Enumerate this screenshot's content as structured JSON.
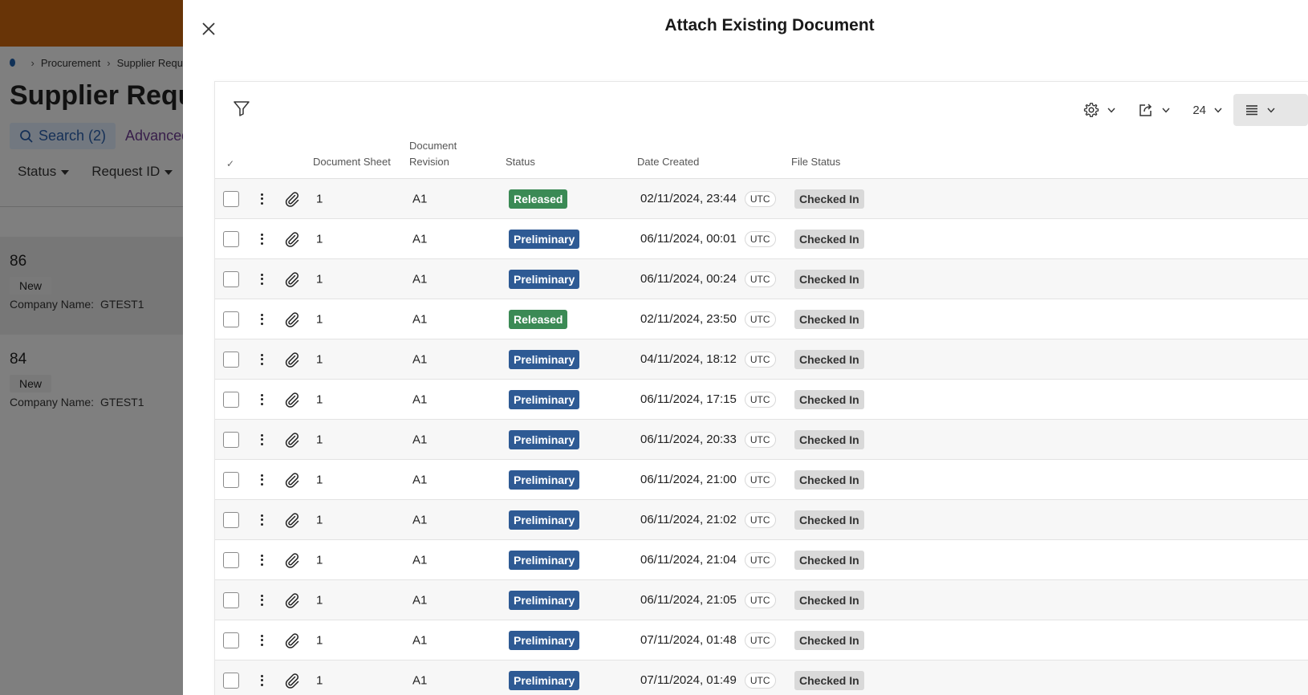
{
  "background": {
    "breadcrumb": [
      "Procurement",
      "Supplier Requ"
    ],
    "page_title": "Supplier Requ",
    "search_label": "Search (2)",
    "advanced_label": "Advanced",
    "filters": [
      "Status",
      "Request ID"
    ],
    "cards": [
      {
        "id": "86",
        "badge": "New",
        "company_label": "Company Name:",
        "company_value": "GTEST1"
      },
      {
        "id": "84",
        "badge": "New",
        "company_label": "Company Name:",
        "company_value": "GTEST1"
      }
    ]
  },
  "dialog": {
    "title": "Attach Existing Document",
    "page_size": "24",
    "columns": {
      "check": "✓",
      "sheet": "Document Sheet",
      "revision_line1": "Document",
      "revision_line2": "Revision",
      "status": "Status",
      "date": "Date Created",
      "file_status": "File Status"
    },
    "rows": [
      {
        "sheet": "1",
        "revision": "A1",
        "status": "Released",
        "status_type": "released",
        "date": "02/11/2024, 23:44",
        "tz": "UTC",
        "file_status": "Checked In"
      },
      {
        "sheet": "1",
        "revision": "A1",
        "status": "Preliminary",
        "status_type": "preliminary",
        "date": "06/11/2024, 00:01",
        "tz": "UTC",
        "file_status": "Checked In"
      },
      {
        "sheet": "1",
        "revision": "A1",
        "status": "Preliminary",
        "status_type": "preliminary",
        "date": "06/11/2024, 00:24",
        "tz": "UTC",
        "file_status": "Checked In"
      },
      {
        "sheet": "1",
        "revision": "A1",
        "status": "Released",
        "status_type": "released",
        "date": "02/11/2024, 23:50",
        "tz": "UTC",
        "file_status": "Checked In"
      },
      {
        "sheet": "1",
        "revision": "A1",
        "status": "Preliminary",
        "status_type": "preliminary",
        "date": "04/11/2024, 18:12",
        "tz": "UTC",
        "file_status": "Checked In"
      },
      {
        "sheet": "1",
        "revision": "A1",
        "status": "Preliminary",
        "status_type": "preliminary",
        "date": "06/11/2024, 17:15",
        "tz": "UTC",
        "file_status": "Checked In"
      },
      {
        "sheet": "1",
        "revision": "A1",
        "status": "Preliminary",
        "status_type": "preliminary",
        "date": "06/11/2024, 20:33",
        "tz": "UTC",
        "file_status": "Checked In"
      },
      {
        "sheet": "1",
        "revision": "A1",
        "status": "Preliminary",
        "status_type": "preliminary",
        "date": "06/11/2024, 21:00",
        "tz": "UTC",
        "file_status": "Checked In"
      },
      {
        "sheet": "1",
        "revision": "A1",
        "status": "Preliminary",
        "status_type": "preliminary",
        "date": "06/11/2024, 21:02",
        "tz": "UTC",
        "file_status": "Checked In"
      },
      {
        "sheet": "1",
        "revision": "A1",
        "status": "Preliminary",
        "status_type": "preliminary",
        "date": "06/11/2024, 21:04",
        "tz": "UTC",
        "file_status": "Checked In"
      },
      {
        "sheet": "1",
        "revision": "A1",
        "status": "Preliminary",
        "status_type": "preliminary",
        "date": "06/11/2024, 21:05",
        "tz": "UTC",
        "file_status": "Checked In"
      },
      {
        "sheet": "1",
        "revision": "A1",
        "status": "Preliminary",
        "status_type": "preliminary",
        "date": "07/11/2024, 01:48",
        "tz": "UTC",
        "file_status": "Checked In"
      },
      {
        "sheet": "1",
        "revision": "A1",
        "status": "Preliminary",
        "status_type": "preliminary",
        "date": "07/11/2024, 01:49",
        "tz": "UTC",
        "file_status": "Checked In"
      }
    ]
  },
  "colors": {
    "released": "#3b8a55",
    "preliminary": "#2e5a94",
    "topbar": "#c8640f"
  },
  "icons": {
    "close": "close-icon",
    "filter": "filter-icon",
    "settings": "gear-icon",
    "export": "export-icon",
    "view": "list-view-icon",
    "row_menu": "kebab-icon",
    "attach": "paperclip-icon"
  }
}
